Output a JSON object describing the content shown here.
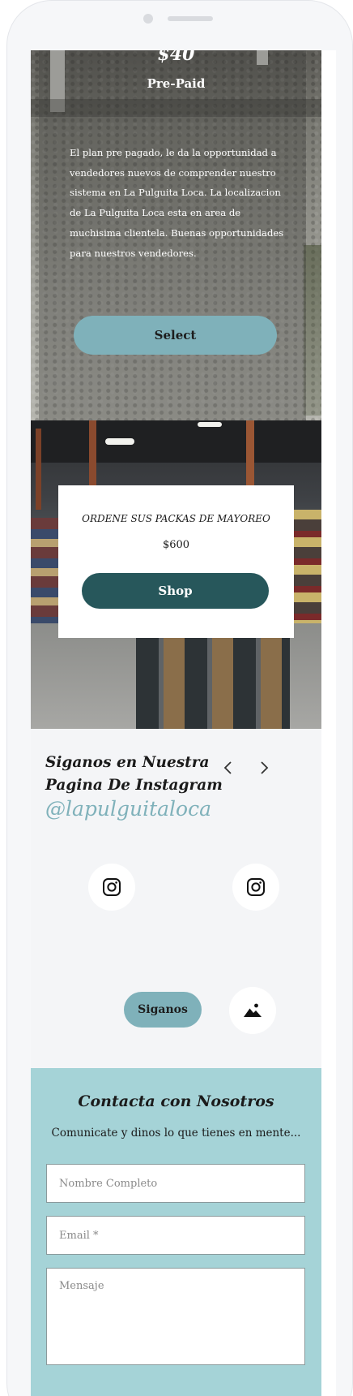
{
  "plan": {
    "price": "$40",
    "name": "Pre-Paid",
    "description": "El plan pre pagado, le da la opportunidad a vendedores nuevos de comprender nuestro sistema en La Pulguita Loca. La localizacion de La Pulguita Loca esta en area de muchisima clientela. Buenas opportunidades para nuestros vendedores.",
    "select_label": "Select"
  },
  "wholesale": {
    "title": "ORDENE SUS PACKAS DE MAYOREO",
    "price": "$600",
    "shop_label": "Shop"
  },
  "instagram": {
    "title": "Siganos en Nuestra Pagina De Instagram",
    "handle": "@lapulguitaloca",
    "follow_label": "Siganos",
    "icons": [
      "chevron-left-icon",
      "chevron-right-icon",
      "instagram-icon",
      "instagram-icon",
      "image-icon"
    ]
  },
  "contact": {
    "title": "Contacta con Nosotros",
    "subtitle": "Comunicate y dinos lo que tienes en mente...",
    "name_placeholder": "Nombre Completo",
    "email_placeholder": "Email *",
    "message_placeholder": "Mensaje"
  },
  "colors": {
    "accent": "#7fb1ba",
    "dark_teal": "#27575b",
    "contact_bg": "#a5d3d7"
  }
}
